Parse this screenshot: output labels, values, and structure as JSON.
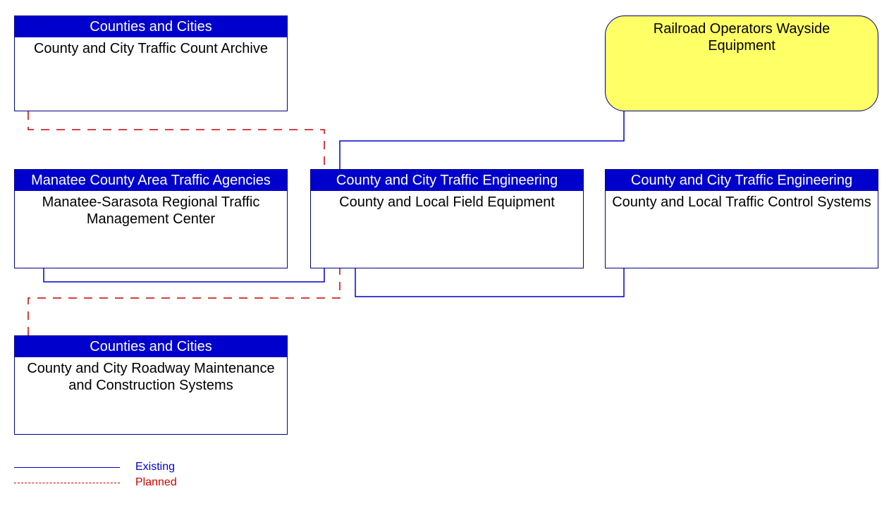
{
  "nodes": {
    "archive": {
      "header": "Counties and Cities",
      "body": "County and City Traffic Count Archive"
    },
    "regional_tmc": {
      "header": "Manatee County Area Traffic Agencies",
      "body": "Manatee-Sarasota Regional Traffic Management Center"
    },
    "field_equipment": {
      "header": "County and City Traffic Engineering",
      "body": "County and Local Field Equipment"
    },
    "traffic_control": {
      "header": "County and City Traffic Engineering",
      "body": "County and Local Traffic Control Systems"
    },
    "maintenance": {
      "header": "Counties and Cities",
      "body": "County and City Roadway Maintenance and Construction Systems"
    },
    "railroad": {
      "label": "Railroad Operators Wayside Equipment"
    }
  },
  "legend": {
    "existing": "Existing",
    "planned": "Planned"
  },
  "chart_data": {
    "type": "diagram",
    "title": "",
    "nodes": [
      {
        "id": "archive",
        "stakeholder": "Counties and Cities",
        "element": "County and City Traffic Count Archive",
        "style": "standard"
      },
      {
        "id": "regional_tmc",
        "stakeholder": "Manatee County Area Traffic Agencies",
        "element": "Manatee-Sarasota Regional Traffic Management Center",
        "style": "standard"
      },
      {
        "id": "field_equipment",
        "stakeholder": "County and City Traffic Engineering",
        "element": "County and Local Field Equipment",
        "style": "standard"
      },
      {
        "id": "traffic_control",
        "stakeholder": "County and City Traffic Engineering",
        "element": "County and Local Traffic Control Systems",
        "style": "standard"
      },
      {
        "id": "maintenance",
        "stakeholder": "Counties and Cities",
        "element": "County and City Roadway Maintenance and Construction Systems",
        "style": "standard"
      },
      {
        "id": "railroad",
        "stakeholder": "",
        "element": "Railroad Operators Wayside Equipment",
        "style": "yellow-rounded"
      }
    ],
    "edges": [
      {
        "from": "archive",
        "to": "field_equipment",
        "status": "planned"
      },
      {
        "from": "maintenance",
        "to": "field_equipment",
        "status": "planned"
      },
      {
        "from": "regional_tmc",
        "to": "field_equipment",
        "status": "existing"
      },
      {
        "from": "traffic_control",
        "to": "field_equipment",
        "status": "existing"
      },
      {
        "from": "railroad",
        "to": "field_equipment",
        "status": "existing"
      }
    ],
    "legend": [
      {
        "label": "Existing",
        "style": "solid",
        "color": "#0000cd"
      },
      {
        "label": "Planned",
        "style": "dashed",
        "color": "#cc0000"
      }
    ]
  }
}
